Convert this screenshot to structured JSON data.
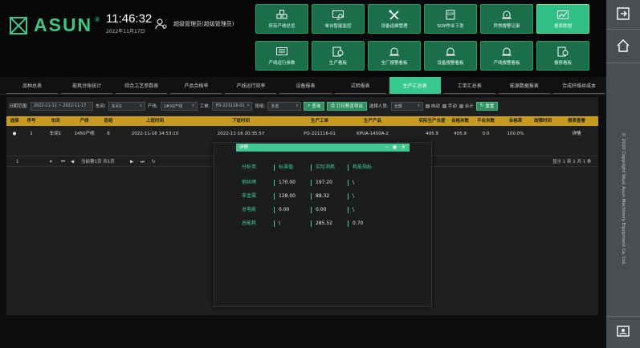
{
  "header": {
    "brand": "ASUN",
    "brand_mark": "®",
    "time": "11:46:32",
    "date": "2022年11月17日",
    "user": "超级管理员(超级管理员)",
    "tiles": [
      {
        "label": "所有产线总览",
        "icon": "boxes-icon"
      },
      {
        "label": "单台智能监控",
        "icon": "monitor-gear-icon"
      },
      {
        "label": "设备运维管理",
        "icon": "wrench-tools-icon"
      },
      {
        "label": "SOP作业下发",
        "icon": "sop-document-icon"
      },
      {
        "label": "异常报警记录",
        "icon": "alarm-bell-icon"
      },
      {
        "label": "报表数据",
        "icon": "report-chart-icon",
        "active": true
      },
      {
        "label": "产线运行参数",
        "icon": "panel-settings-icon"
      },
      {
        "label": "生产看板",
        "icon": "dashboard-clock-icon"
      },
      {
        "label": "全厂报警看板",
        "icon": "alarm-board-icon"
      },
      {
        "label": "设备报警看板",
        "icon": "alarm-board-icon"
      },
      {
        "label": "产线报警看板",
        "icon": "alarm-board-icon"
      },
      {
        "label": "报修看板",
        "icon": "repair-board-icon"
      }
    ]
  },
  "tabs": [
    "品种总表",
    "能耗台账统计",
    "综合工艺参数表",
    "产品合格率",
    "产线运行效率",
    "设备报表",
    "试验报表",
    "生产汇总表",
    "工单汇总表",
    "能源数据报表",
    "合成纤维丝成本"
  ],
  "active_tab": 7,
  "filters": {
    "date_label": "日期范围:",
    "date_value": "2022-11-11 ~ 2022-11-17",
    "workshop_label": "车间:",
    "workshop_value": "车间1",
    "line_label": "产线:",
    "line_value": "1#50产线",
    "order_label": "工单:",
    "order_value": "PO-221116-01",
    "shift_label": "班组:",
    "shift_value": "多选",
    "query": "查询",
    "export": "打印预览导出",
    "add_label": "选择人员:",
    "add_value": "全部",
    "checks": [
      "自动",
      "手动",
      "合计"
    ],
    "reset": "重置"
  },
  "table": {
    "headers": [
      "选择",
      "序号",
      "车间",
      "产线",
      "班组",
      "上班时间",
      "下班时间",
      "生产工单",
      "生产产品",
      "实际生产长度",
      "合格米数",
      "不合米数",
      "合格率",
      "故障时间",
      "报表查看"
    ],
    "rows": [
      [
        "●",
        "1",
        "车间1",
        "1450产线",
        "8",
        "2022-11-16 14:53:10",
        "2022-11-16 20:35:57",
        "PO-221116-01",
        "KPUA-1450A-2",
        "405.9",
        "405.9",
        "0.0",
        "100.0%",
        "",
        "详情"
      ]
    ]
  },
  "pager": {
    "page_size": "1",
    "page_text": "当前第1页 共1页",
    "summary": "显示 1 到 1 共 1 条"
  },
  "modal": {
    "title": "详情",
    "headers": [
      "分析项",
      "标准值",
      "实际消耗",
      "耗能指标"
    ],
    "rows": [
      {
        "item": "钢丝绳",
        "standard": "170.00",
        "actual": "197.20",
        "index": "\\"
      },
      {
        "item": "非金属",
        "standard": "128.00",
        "actual": "88.32",
        "index": "\\"
      },
      {
        "item": "总电能",
        "standard": "0.00",
        "actual": "0.00",
        "index": "\\"
      },
      {
        "item": "总能耗",
        "standard": "\\",
        "actual": "285.52",
        "index": "0.70"
      }
    ]
  },
  "sidebar": {
    "copyright": "© 2020 Copyright Wuxi Asun Machinery Equipment Co. Ltd."
  },
  "colors": {
    "accent": "#37c88a",
    "tile": "#1a6e4a",
    "table_header": "#c79b1f",
    "sidebar": "#4a4d52"
  }
}
